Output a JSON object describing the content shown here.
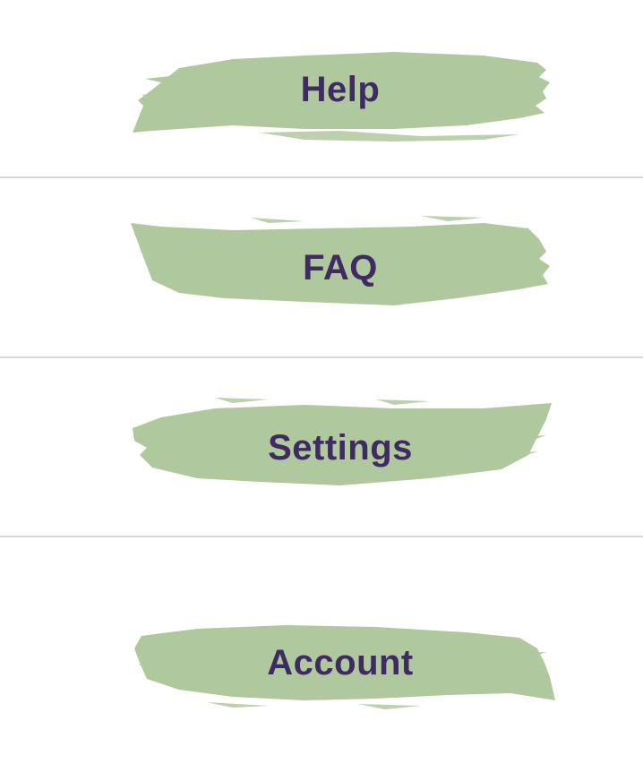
{
  "colors": {
    "brush": "#b0c89e",
    "text": "#3f2a62",
    "divider": "#d6d6d6",
    "background": "#ffffff"
  },
  "menu": {
    "items": [
      {
        "label": "Help"
      },
      {
        "label": "FAQ"
      },
      {
        "label": "Settings"
      },
      {
        "label": "Account"
      }
    ]
  }
}
